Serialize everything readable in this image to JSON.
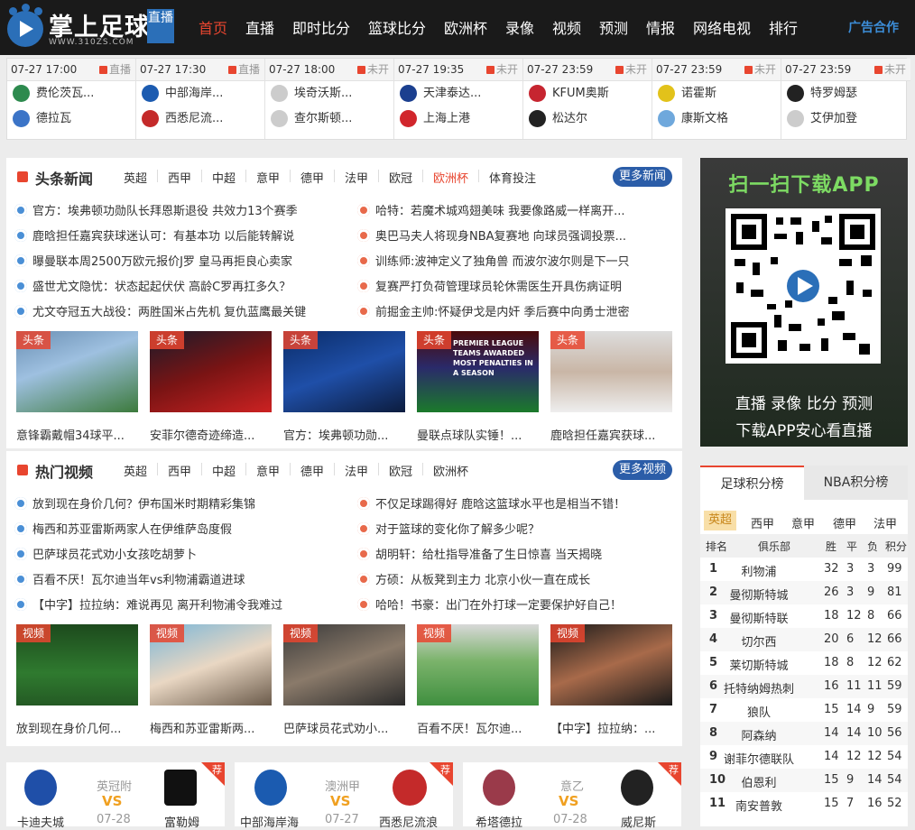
{
  "logo": {
    "title": "掌上足球",
    "badge": "直播",
    "url": "WWW.310ZS.COM"
  },
  "nav": {
    "items": [
      "首页",
      "直播",
      "即时比分",
      "篮球比分",
      "欧洲杯",
      "录像",
      "视频",
      "预测",
      "情报",
      "网络电视",
      "排行"
    ],
    "ad": "广告合作"
  },
  "matches": [
    {
      "time": "07-27 17:00",
      "status": "直播",
      "home": "费伦茨瓦...",
      "away": "德拉瓦"
    },
    {
      "time": "07-27 17:30",
      "status": "直播",
      "home": "中部海岸...",
      "away": "西悉尼流..."
    },
    {
      "time": "07-27 18:00",
      "status": "未开",
      "home": "埃奇沃斯...",
      "away": "查尔斯顿..."
    },
    {
      "time": "07-27 19:35",
      "status": "未开",
      "home": "天津泰达...",
      "away": "上海上港"
    },
    {
      "time": "07-27 23:59",
      "status": "未开",
      "home": "KFUM奥斯",
      "away": "松达尔"
    },
    {
      "time": "07-27 23:59",
      "status": "未开",
      "home": "诺霍斯",
      "away": "康斯文格"
    },
    {
      "time": "07-27 23:59",
      "status": "未开",
      "home": "特罗姆瑟",
      "away": "艾伊加登"
    }
  ],
  "news": {
    "title": "头条新闻",
    "tabs": [
      "英超",
      "西甲",
      "中超",
      "意甲",
      "德甲",
      "法甲",
      "欧冠",
      "欧洲杯",
      "体育投注"
    ],
    "more": "更多新闻",
    "left": [
      "官方：埃弗顿功勋队长拜恩斯退役 共效力13个赛季",
      "鹿晗担任嘉宾获球迷认可：有基本功 以后能转解说",
      "曝曼联本周2500万欧元报价J罗 皇马再拒良心卖家",
      "盛世尤文隐忧：状态起起伏伏 高龄C罗再扛多久？",
      "尤文夺冠五大战役：两胜国米占先机 复仇蓝鹰最关键"
    ],
    "right": [
      "哈特：若魔术城鸡翅美味 我要像路威一样离开...",
      "奥巴马夫人将现身NBA复赛地 向球员强调投票...",
      "训练师:波神定义了独角兽 而波尔波尔则是下一只",
      "复赛严打负荷管理球员轮休需医生开具伤病证明",
      "前掘金主帅:怀疑伊戈是内奸 季后赛中向勇士泄密"
    ],
    "tag": "头条",
    "captions": [
      "意锋霸戴帽34球平...",
      "安菲尔德奇迹缔造...",
      "官方：埃弗顿功勋...",
      "曼联点球队实锤！...",
      "鹿晗担任嘉宾获球..."
    ],
    "thumb_text": "PREMIER LEAGUE TEAMS AWARDED MOST PENALTIES IN A SEASON"
  },
  "videos": {
    "title": "热门视频",
    "tabs": [
      "英超",
      "西甲",
      "中超",
      "意甲",
      "德甲",
      "法甲",
      "欧冠",
      "欧洲杯"
    ],
    "more": "更多视频",
    "left": [
      "放到现在身价几何？伊布国米时期精彩集锦",
      "梅西和苏亚雷斯两家人在伊维萨岛度假",
      "巴萨球员花式劝小女孩吃胡萝卜",
      "百看不厌！瓦尔迪当年vs利物浦霸道进球",
      "【中字】拉拉纳：难说再见 离开利物浦令我难过"
    ],
    "right": [
      "不仅足球踢得好 鹿晗这篮球水平也是相当不错！",
      "对于篮球的变化你了解多少呢？",
      "胡明轩：给杜指导准备了生日惊喜 当天揭晓",
      "方硕：从板凳到主力 北京小伙一直在成长",
      "哈哈！书豪：出门在外打球一定要保护好自己！"
    ],
    "tag": "视频",
    "captions": [
      "放到现在身价几何...",
      "梅西和苏亚雷斯两...",
      "巴萨球员花式劝小...",
      "百看不厌！瓦尔迪...",
      "【中字】拉拉纳：..."
    ]
  },
  "app": {
    "title": "扫一扫下载APP",
    "line1": "直播 录像 比分 预测",
    "line2": "下载APP安心看直播"
  },
  "standings": {
    "tabs": [
      "足球积分榜",
      "NBA积分榜"
    ],
    "leagues": [
      "英超",
      "西甲",
      "意甲",
      "德甲",
      "法甲"
    ],
    "headers": [
      "排名",
      "俱乐部",
      "胜",
      "平",
      "负",
      "积分"
    ],
    "rows": [
      [
        "1",
        "利物浦",
        "32",
        "3",
        "3",
        "99"
      ],
      [
        "2",
        "曼彻斯特城",
        "26",
        "3",
        "9",
        "81"
      ],
      [
        "3",
        "曼彻斯特联",
        "18",
        "12",
        "8",
        "66"
      ],
      [
        "4",
        "切尔西",
        "20",
        "6",
        "12",
        "66"
      ],
      [
        "5",
        "莱切斯特城",
        "18",
        "8",
        "12",
        "62"
      ],
      [
        "6",
        "托特纳姆热刺",
        "16",
        "11",
        "11",
        "59"
      ],
      [
        "7",
        "狼队",
        "15",
        "14",
        "9",
        "59"
      ],
      [
        "8",
        "阿森纳",
        "14",
        "14",
        "10",
        "56"
      ],
      [
        "9",
        "谢菲尔德联队",
        "14",
        "12",
        "12",
        "54"
      ],
      [
        "10",
        "伯恩利",
        "15",
        "9",
        "14",
        "54"
      ],
      [
        "11",
        "南安普敦",
        "15",
        "7",
        "16",
        "52"
      ]
    ]
  },
  "fixtures": [
    {
      "league": "英冠附",
      "vs": "VS",
      "date": "07-28",
      "home": "卡迪夫城",
      "away": "富勒姆",
      "tag": "荐"
    },
    {
      "league": "澳洲甲",
      "vs": "VS",
      "date": "07-27",
      "home": "中部海岸海",
      "away": "西悉尼流浪",
      "tag": "荐"
    },
    {
      "league": "意乙",
      "vs": "VS",
      "date": "07-28",
      "home": "希塔德拉",
      "away": "威尼斯",
      "tag": "荐"
    }
  ],
  "colors": {
    "accent": "#e8452f",
    "blue": "#2b5da8",
    "nav_bg": "#1a1a1a"
  }
}
